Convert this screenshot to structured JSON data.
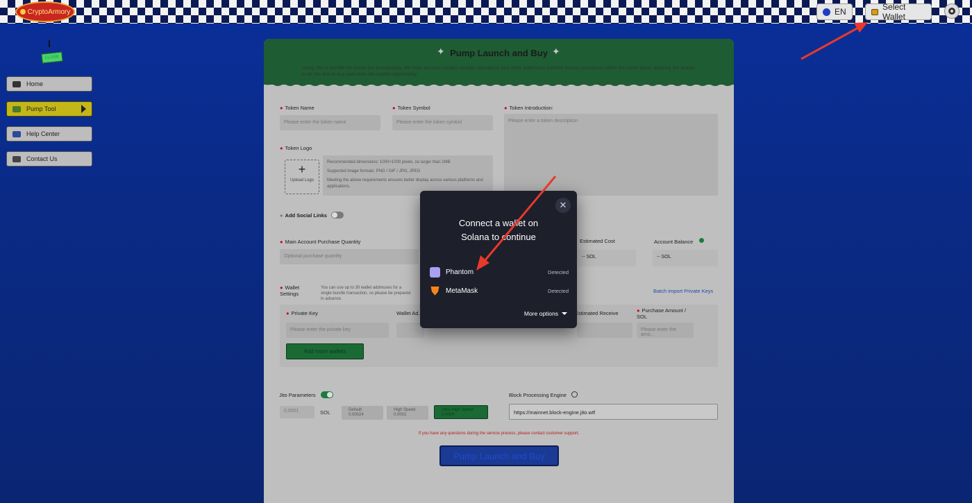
{
  "header": {
    "logo_text": "CryptoArmory",
    "language": "EN",
    "select_wallet": "Select Wallet"
  },
  "sidebar": {
    "mascot_tag": "CLOSE",
    "items": [
      {
        "label": "Home",
        "icon": "home-icon"
      },
      {
        "label": "Pump Tool",
        "icon": "pump-icon"
      },
      {
        "label": "Help Center",
        "icon": "help-icon"
      },
      {
        "label": "Contact Us",
        "icon": "send-icon"
      }
    ]
  },
  "form": {
    "title": "Pump Launch and Buy",
    "description": "Using Jito to bundle the pump.fun functionality, the main account creates liquidity operations and other addresses perform buying operations within the same block, allowing the launch to be the first to buy and seize the market opportunity.",
    "token_name_label": "Token Name",
    "token_name_placeholder": "Please enter the token name",
    "token_symbol_label": "Token Symbol",
    "token_symbol_placeholder": "Please enter the token symbol",
    "token_intro_label": "Token Introduction:",
    "token_intro_placeholder": "Please enter a token description",
    "token_logo_label": "Token Logo",
    "upload_label": "Upload Logo",
    "logo_hint_1": "Recommended dimensions: 1000×1000 pixels, no larger than 2MB",
    "logo_hint_2": "Supported image formats: PNG / GIF / JPG, JPEG",
    "logo_hint_3": "Meeting the above requirements ensures better display across various platforms and applications.",
    "social_links_label": "Add Social Links",
    "main_qty_label": "Main Account Purchase Quantity",
    "main_qty_placeholder": "Optional purchase quantity",
    "estimated_cost_label": "Estimated Cost",
    "estimated_cost_value": "-- SOL",
    "account_balance_label": "Account Balance",
    "account_balance_value": "-- SOL",
    "wallet_settings_label": "Wallet Settings",
    "wallet_settings_hint": "You can use up to 30 wallet addresses for a single bundle transaction, so please be prepared in advance.",
    "batch_import": "Batch import Private Keys",
    "private_key_label": "Private Key",
    "private_key_placeholder": "Please enter the private key",
    "wallet_address_label": "Wallet Ad...",
    "estimated_receive_label": "Estimated Receive",
    "purchase_amount_label": "Purchase Amount / SOL",
    "purchase_amount_placeholder": "Please enter the amo...",
    "add_wallets": "Add more wallets",
    "jito_label": "Jito Parameters",
    "jito_value": "0.0001",
    "jito_unit": "SOL",
    "jito_default": "Default",
    "jito_default_val": "0.00024",
    "jito_high": "High Speed",
    "jito_high_val": "0.0001",
    "jito_ultra": "Ultra High Speed",
    "jito_ultra_val": "0.0004",
    "engine_label": "Block Processing Engine",
    "engine_value": "https://mainnet.block-engine.jito.wtf",
    "support_note": "If you have any questions during the service process, please contact customer support.",
    "submit": "Pump Launch and Buy"
  },
  "modal": {
    "title": "Connect a wallet on Solana to continue",
    "close_icon": "close-icon",
    "wallets": [
      {
        "name": "Phantom",
        "status": "Detected",
        "color": "#ab9ff2"
      },
      {
        "name": "MetaMask",
        "status": "Detected",
        "color": "#f6851b"
      }
    ],
    "more_options": "More options"
  },
  "colors": {
    "annotation_arrow": "#e8392b",
    "accent_green": "#1e5c33",
    "modal_bg": "#1d1f2b"
  }
}
